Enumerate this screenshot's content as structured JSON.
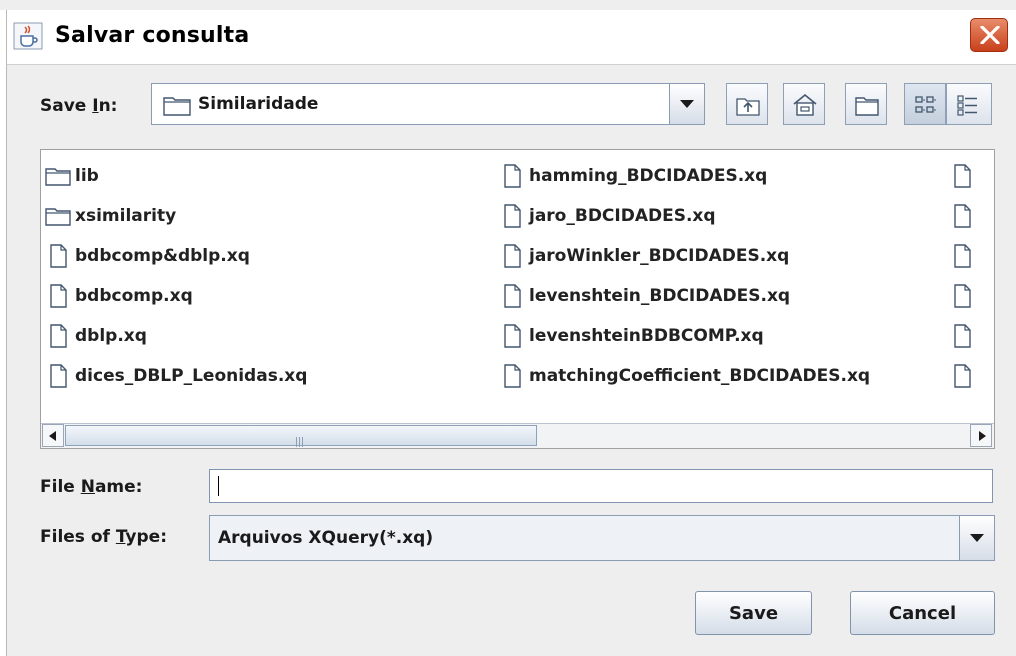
{
  "window": {
    "title": "Salvar consulta",
    "icons": {
      "app": "java-cup-icon",
      "close": "close-icon"
    }
  },
  "save_in": {
    "label_pre": "Save ",
    "label_mnemonic": "I",
    "label_post": "n:",
    "value": "Similaridade",
    "icon": "folder-icon"
  },
  "toolbar": {
    "buttons": [
      {
        "name": "up-one-level",
        "icon": "up-folder-icon"
      },
      {
        "name": "home",
        "icon": "home-icon"
      },
      {
        "name": "new-folder",
        "icon": "new-folder-icon"
      },
      {
        "name": "list-view",
        "icon": "list-view-icon"
      },
      {
        "name": "details-view",
        "icon": "details-view-icon"
      }
    ]
  },
  "files": {
    "column1": [
      {
        "name": "lib",
        "type": "folder"
      },
      {
        "name": "xsimilarity",
        "type": "folder"
      },
      {
        "name": "bdbcomp&dblp.xq",
        "type": "file"
      },
      {
        "name": "bdbcomp.xq",
        "type": "file"
      },
      {
        "name": "dblp.xq",
        "type": "file"
      },
      {
        "name": "dices_DBLP_Leonidas.xq",
        "type": "file"
      }
    ],
    "column2": [
      {
        "name": "hamming_BDCIDADES.xq",
        "type": "file"
      },
      {
        "name": "jaro_BDCIDADES.xq",
        "type": "file"
      },
      {
        "name": "jaroWinkler_BDCIDADES.xq",
        "type": "file"
      },
      {
        "name": "levenshtein_BDCIDADES.xq",
        "type": "file"
      },
      {
        "name": "levenshteinBDBCOMP.xq",
        "type": "file"
      },
      {
        "name": "matchingCoefficient_BDCIDADES.xq",
        "type": "file"
      }
    ],
    "column3_partial": [
      {
        "type": "file"
      },
      {
        "type": "file"
      },
      {
        "type": "file"
      },
      {
        "type": "file"
      },
      {
        "type": "file"
      },
      {
        "type": "file"
      }
    ]
  },
  "file_name": {
    "label_pre": "File ",
    "label_mnemonic": "N",
    "label_post": "ame:",
    "value": ""
  },
  "files_of_type": {
    "label_pre": "Files of ",
    "label_mnemonic": "T",
    "label_post": "ype:",
    "value": "Arquivos XQuery(*.xq)"
  },
  "buttons": {
    "save": "Save",
    "cancel": "Cancel"
  },
  "colors": {
    "close_button": "#d2522c",
    "thumb": "#d3deea",
    "panel": "#eeeeee"
  }
}
